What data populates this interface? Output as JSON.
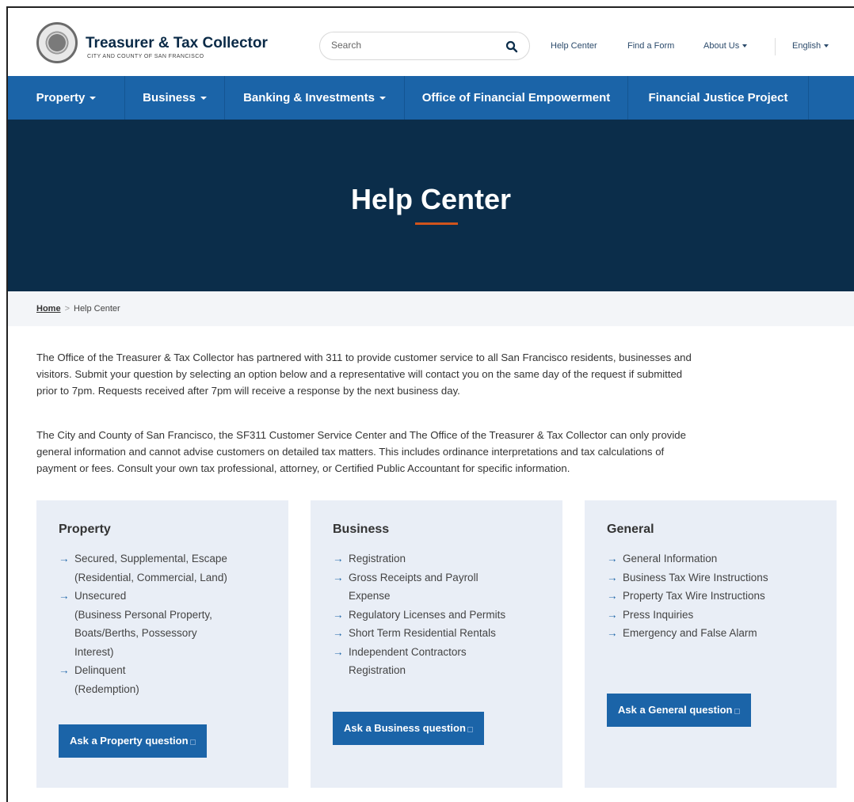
{
  "header": {
    "brand_title": "Treasurer & Tax Collector",
    "brand_sub": "CITY AND COUNTY OF SAN FRANCISCO",
    "search_placeholder": "Search",
    "links": {
      "help_center": "Help Center",
      "find_form": "Find a Form",
      "about_us": "About Us",
      "language": "English"
    }
  },
  "nav": {
    "property": "Property",
    "business": "Business",
    "banking": "Banking & Investments",
    "empowerment": "Office of Financial Empowerment",
    "justice": "Financial Justice Project"
  },
  "hero": {
    "title": "Help Center"
  },
  "breadcrumb": {
    "home": "Home",
    "separator": ">",
    "current": "Help Center"
  },
  "intro": {
    "p1_line1": "The Office of the Treasurer & Tax Collector has partnered with 311 to provide customer service to all San Francisco residents, businesses and",
    "p1_line2": "visitors. Submit your question by selecting an option below and a representative will contact you on the same day of the request if submitted",
    "p1_line3": "prior to 7pm. Requests received after 7pm will receive a response by the next business day.",
    "p2_line1": "The City and County of San Francisco, the SF311 Customer Service Center and The Office of the Treasurer & Tax Collector can only provide",
    "p2_line2": "general information and cannot advise customers on detailed tax matters. This includes ordinance interpretations and tax calculations of",
    "p2_line3": "payment or fees.  Consult your own tax professional, attorney, or Certified Public Accountant for specific information."
  },
  "cards": {
    "property": {
      "title": "Property",
      "items": [
        [
          "Secured, Supplemental, Escape",
          "(Residential, Commercial, Land)"
        ],
        [
          "Unsecured",
          "(Business Personal Property,",
          "Boats/Berths, Possessory",
          "Interest)"
        ],
        [
          "Delinquent",
          "(Redemption)"
        ]
      ],
      "button": "Ask a Property question"
    },
    "business": {
      "title": "Business",
      "items": [
        [
          "Registration"
        ],
        [
          "Gross Receipts and Payroll",
          "Expense"
        ],
        [
          "Regulatory Licenses and Permits"
        ],
        [
          "Short Term Residential Rentals"
        ],
        [
          "Independent Contractors",
          "Registration"
        ]
      ],
      "button": "Ask a Business question"
    },
    "general": {
      "title": "General",
      "items": [
        [
          "General Information"
        ],
        [
          "Business Tax Wire Instructions"
        ],
        [
          "Property Tax Wire Instructions"
        ],
        [
          "Press Inquiries"
        ],
        [
          "Emergency and False Alarm"
        ]
      ],
      "button": "Ask a General question"
    }
  },
  "colors": {
    "nav_blue": "#1b64a8",
    "hero_navy": "#0b2d4a",
    "accent_orange": "#d0541c",
    "card_bg": "#e9eef6"
  }
}
